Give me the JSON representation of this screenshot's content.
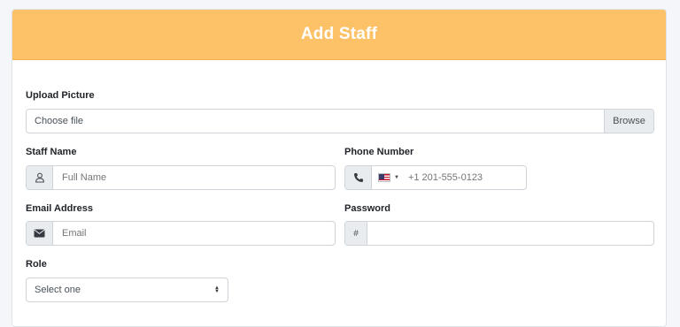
{
  "header": {
    "title": "Add Staff"
  },
  "upload": {
    "label": "Upload Picture",
    "file_text": "Choose file",
    "browse_label": "Browse"
  },
  "staff_name": {
    "label": "Staff Name",
    "placeholder": "Full Name",
    "icon": "user-icon"
  },
  "phone": {
    "label": "Phone Number",
    "placeholder": "+1 201-555-0123",
    "icon": "phone-icon",
    "country": "us-flag"
  },
  "email": {
    "label": "Email Address",
    "placeholder": "Email",
    "icon": "envelope-icon"
  },
  "password": {
    "label": "Password",
    "addon_text": "#"
  },
  "role": {
    "label": "Role",
    "selected": "Select one"
  },
  "colors": {
    "header_bg": "#fdc168",
    "addon_bg": "#e9ecef",
    "border": "#ced4da"
  }
}
